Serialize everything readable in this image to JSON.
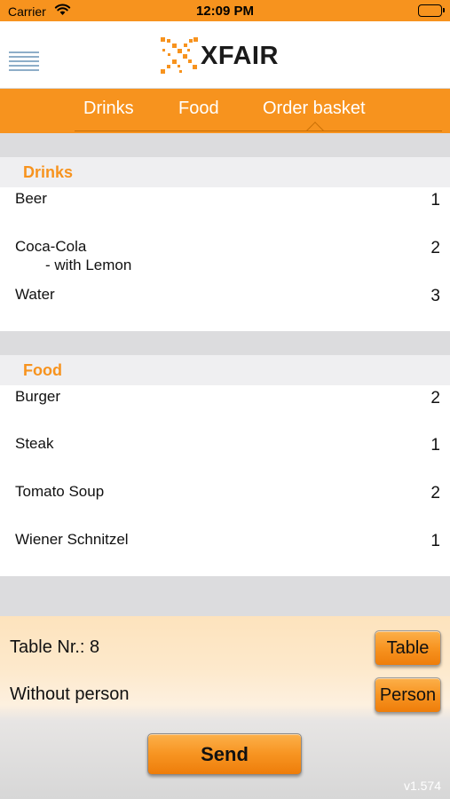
{
  "status_bar": {
    "carrier": "Carrier",
    "time": "12:09 PM"
  },
  "header": {
    "logo_text": "XFAIR",
    "menu_icon": "hamburger-menu-icon"
  },
  "tabs": [
    {
      "label": "Drinks"
    },
    {
      "label": "Food"
    },
    {
      "label": "Order basket",
      "active": true
    }
  ],
  "basket": {
    "sections": [
      {
        "title": "Drinks",
        "items": [
          {
            "name": "Beer",
            "qty": "1"
          },
          {
            "name": "Coca-Cola",
            "note": "- with Lemon",
            "qty": "2"
          },
          {
            "name": "Water",
            "qty": "3"
          }
        ]
      },
      {
        "title": "Food",
        "items": [
          {
            "name": "Burger",
            "qty": "2"
          },
          {
            "name": "Steak",
            "qty": "1"
          },
          {
            "name": "Tomato Soup",
            "qty": "2"
          },
          {
            "name": "Wiener Schnitzel",
            "qty": "1"
          }
        ]
      }
    ]
  },
  "footer": {
    "table_label": "Table Nr.: 8",
    "table_button": "Table",
    "person_label": "Without person",
    "person_button": "Person",
    "send_button": "Send",
    "version": "v1.574"
  },
  "colors": {
    "accent": "#f7931e",
    "section_bg": "#efeff1",
    "band_bg": "#dcdcde"
  }
}
